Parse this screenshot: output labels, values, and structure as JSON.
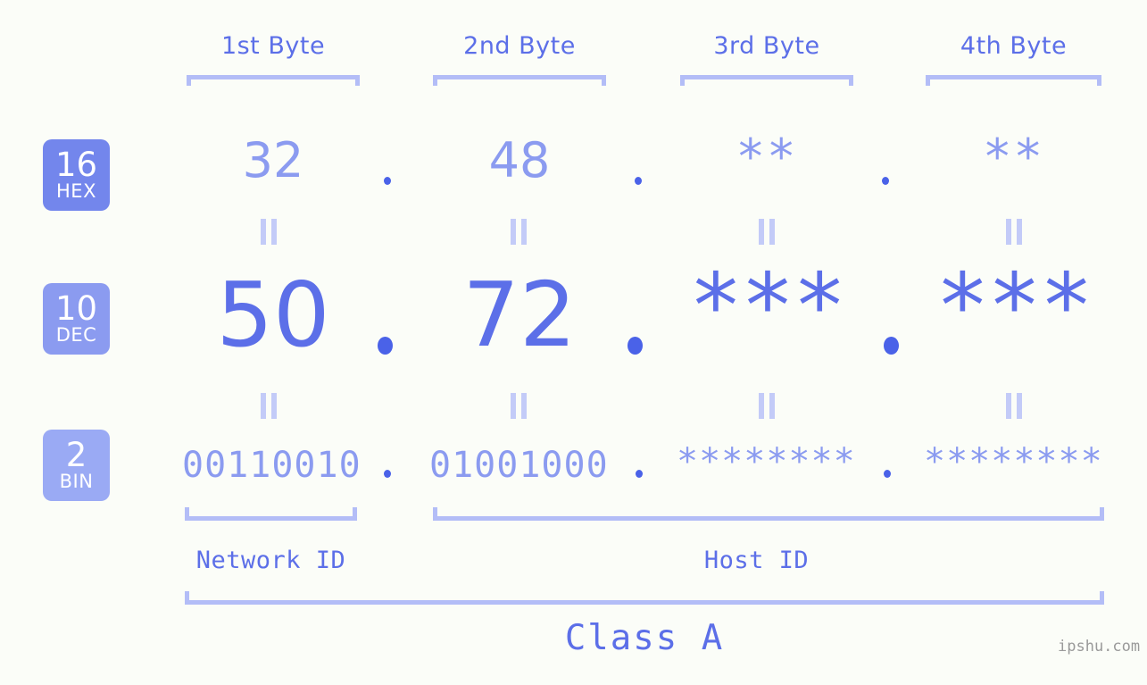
{
  "background_color": "#fbfdf8",
  "accent_color": "#5c6fe8",
  "accent_light_color": "#8b9bf0",
  "bracket_color": "#b3bdf7",
  "header": {
    "bytes": [
      {
        "label": "1st Byte"
      },
      {
        "label": "2nd Byte"
      },
      {
        "label": "3rd Byte"
      },
      {
        "label": "4th Byte"
      }
    ]
  },
  "bases": [
    {
      "number": "16",
      "unit": "HEX",
      "color": "#7386ec"
    },
    {
      "number": "10",
      "unit": "DEC",
      "color": "#8b9bf0"
    },
    {
      "number": "2",
      "unit": "BIN",
      "color": "#9aaaf4"
    }
  ],
  "rows": {
    "hex": {
      "base_number": "16",
      "base_unit": "HEX",
      "values": [
        "32",
        "48",
        "**",
        "**"
      ],
      "separator": "."
    },
    "dec": {
      "base_number": "10",
      "base_unit": "DEC",
      "values": [
        "50",
        "72",
        "***",
        "***"
      ],
      "separator": "."
    },
    "bin": {
      "base_number": "2",
      "base_unit": "BIN",
      "values": [
        "00110010",
        "01001000",
        "********",
        "********"
      ],
      "separator": "."
    }
  },
  "equals_symbol": "||",
  "footer": {
    "network_id_label": "Network ID",
    "host_id_label": "Host ID",
    "class_label": "Class A",
    "watermark": "ipshu.com"
  }
}
